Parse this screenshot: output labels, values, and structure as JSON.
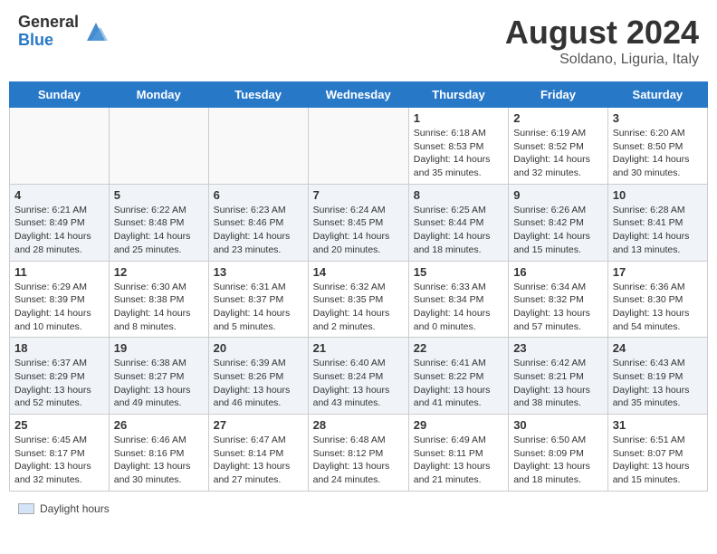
{
  "header": {
    "logo_general": "General",
    "logo_blue": "Blue",
    "month_year": "August 2024",
    "location": "Soldano, Liguria, Italy"
  },
  "footer": {
    "daylight_label": "Daylight hours"
  },
  "days_of_week": [
    "Sunday",
    "Monday",
    "Tuesday",
    "Wednesday",
    "Thursday",
    "Friday",
    "Saturday"
  ],
  "weeks": [
    [
      {
        "num": "",
        "info": ""
      },
      {
        "num": "",
        "info": ""
      },
      {
        "num": "",
        "info": ""
      },
      {
        "num": "",
        "info": ""
      },
      {
        "num": "1",
        "info": "Sunrise: 6:18 AM\nSunset: 8:53 PM\nDaylight: 14 hours and 35 minutes."
      },
      {
        "num": "2",
        "info": "Sunrise: 6:19 AM\nSunset: 8:52 PM\nDaylight: 14 hours and 32 minutes."
      },
      {
        "num": "3",
        "info": "Sunrise: 6:20 AM\nSunset: 8:50 PM\nDaylight: 14 hours and 30 minutes."
      }
    ],
    [
      {
        "num": "4",
        "info": "Sunrise: 6:21 AM\nSunset: 8:49 PM\nDaylight: 14 hours and 28 minutes."
      },
      {
        "num": "5",
        "info": "Sunrise: 6:22 AM\nSunset: 8:48 PM\nDaylight: 14 hours and 25 minutes."
      },
      {
        "num": "6",
        "info": "Sunrise: 6:23 AM\nSunset: 8:46 PM\nDaylight: 14 hours and 23 minutes."
      },
      {
        "num": "7",
        "info": "Sunrise: 6:24 AM\nSunset: 8:45 PM\nDaylight: 14 hours and 20 minutes."
      },
      {
        "num": "8",
        "info": "Sunrise: 6:25 AM\nSunset: 8:44 PM\nDaylight: 14 hours and 18 minutes."
      },
      {
        "num": "9",
        "info": "Sunrise: 6:26 AM\nSunset: 8:42 PM\nDaylight: 14 hours and 15 minutes."
      },
      {
        "num": "10",
        "info": "Sunrise: 6:28 AM\nSunset: 8:41 PM\nDaylight: 14 hours and 13 minutes."
      }
    ],
    [
      {
        "num": "11",
        "info": "Sunrise: 6:29 AM\nSunset: 8:39 PM\nDaylight: 14 hours and 10 minutes."
      },
      {
        "num": "12",
        "info": "Sunrise: 6:30 AM\nSunset: 8:38 PM\nDaylight: 14 hours and 8 minutes."
      },
      {
        "num": "13",
        "info": "Sunrise: 6:31 AM\nSunset: 8:37 PM\nDaylight: 14 hours and 5 minutes."
      },
      {
        "num": "14",
        "info": "Sunrise: 6:32 AM\nSunset: 8:35 PM\nDaylight: 14 hours and 2 minutes."
      },
      {
        "num": "15",
        "info": "Sunrise: 6:33 AM\nSunset: 8:34 PM\nDaylight: 14 hours and 0 minutes."
      },
      {
        "num": "16",
        "info": "Sunrise: 6:34 AM\nSunset: 8:32 PM\nDaylight: 13 hours and 57 minutes."
      },
      {
        "num": "17",
        "info": "Sunrise: 6:36 AM\nSunset: 8:30 PM\nDaylight: 13 hours and 54 minutes."
      }
    ],
    [
      {
        "num": "18",
        "info": "Sunrise: 6:37 AM\nSunset: 8:29 PM\nDaylight: 13 hours and 52 minutes."
      },
      {
        "num": "19",
        "info": "Sunrise: 6:38 AM\nSunset: 8:27 PM\nDaylight: 13 hours and 49 minutes."
      },
      {
        "num": "20",
        "info": "Sunrise: 6:39 AM\nSunset: 8:26 PM\nDaylight: 13 hours and 46 minutes."
      },
      {
        "num": "21",
        "info": "Sunrise: 6:40 AM\nSunset: 8:24 PM\nDaylight: 13 hours and 43 minutes."
      },
      {
        "num": "22",
        "info": "Sunrise: 6:41 AM\nSunset: 8:22 PM\nDaylight: 13 hours and 41 minutes."
      },
      {
        "num": "23",
        "info": "Sunrise: 6:42 AM\nSunset: 8:21 PM\nDaylight: 13 hours and 38 minutes."
      },
      {
        "num": "24",
        "info": "Sunrise: 6:43 AM\nSunset: 8:19 PM\nDaylight: 13 hours and 35 minutes."
      }
    ],
    [
      {
        "num": "25",
        "info": "Sunrise: 6:45 AM\nSunset: 8:17 PM\nDaylight: 13 hours and 32 minutes."
      },
      {
        "num": "26",
        "info": "Sunrise: 6:46 AM\nSunset: 8:16 PM\nDaylight: 13 hours and 30 minutes."
      },
      {
        "num": "27",
        "info": "Sunrise: 6:47 AM\nSunset: 8:14 PM\nDaylight: 13 hours and 27 minutes."
      },
      {
        "num": "28",
        "info": "Sunrise: 6:48 AM\nSunset: 8:12 PM\nDaylight: 13 hours and 24 minutes."
      },
      {
        "num": "29",
        "info": "Sunrise: 6:49 AM\nSunset: 8:11 PM\nDaylight: 13 hours and 21 minutes."
      },
      {
        "num": "30",
        "info": "Sunrise: 6:50 AM\nSunset: 8:09 PM\nDaylight: 13 hours and 18 minutes."
      },
      {
        "num": "31",
        "info": "Sunrise: 6:51 AM\nSunset: 8:07 PM\nDaylight: 13 hours and 15 minutes."
      }
    ]
  ]
}
